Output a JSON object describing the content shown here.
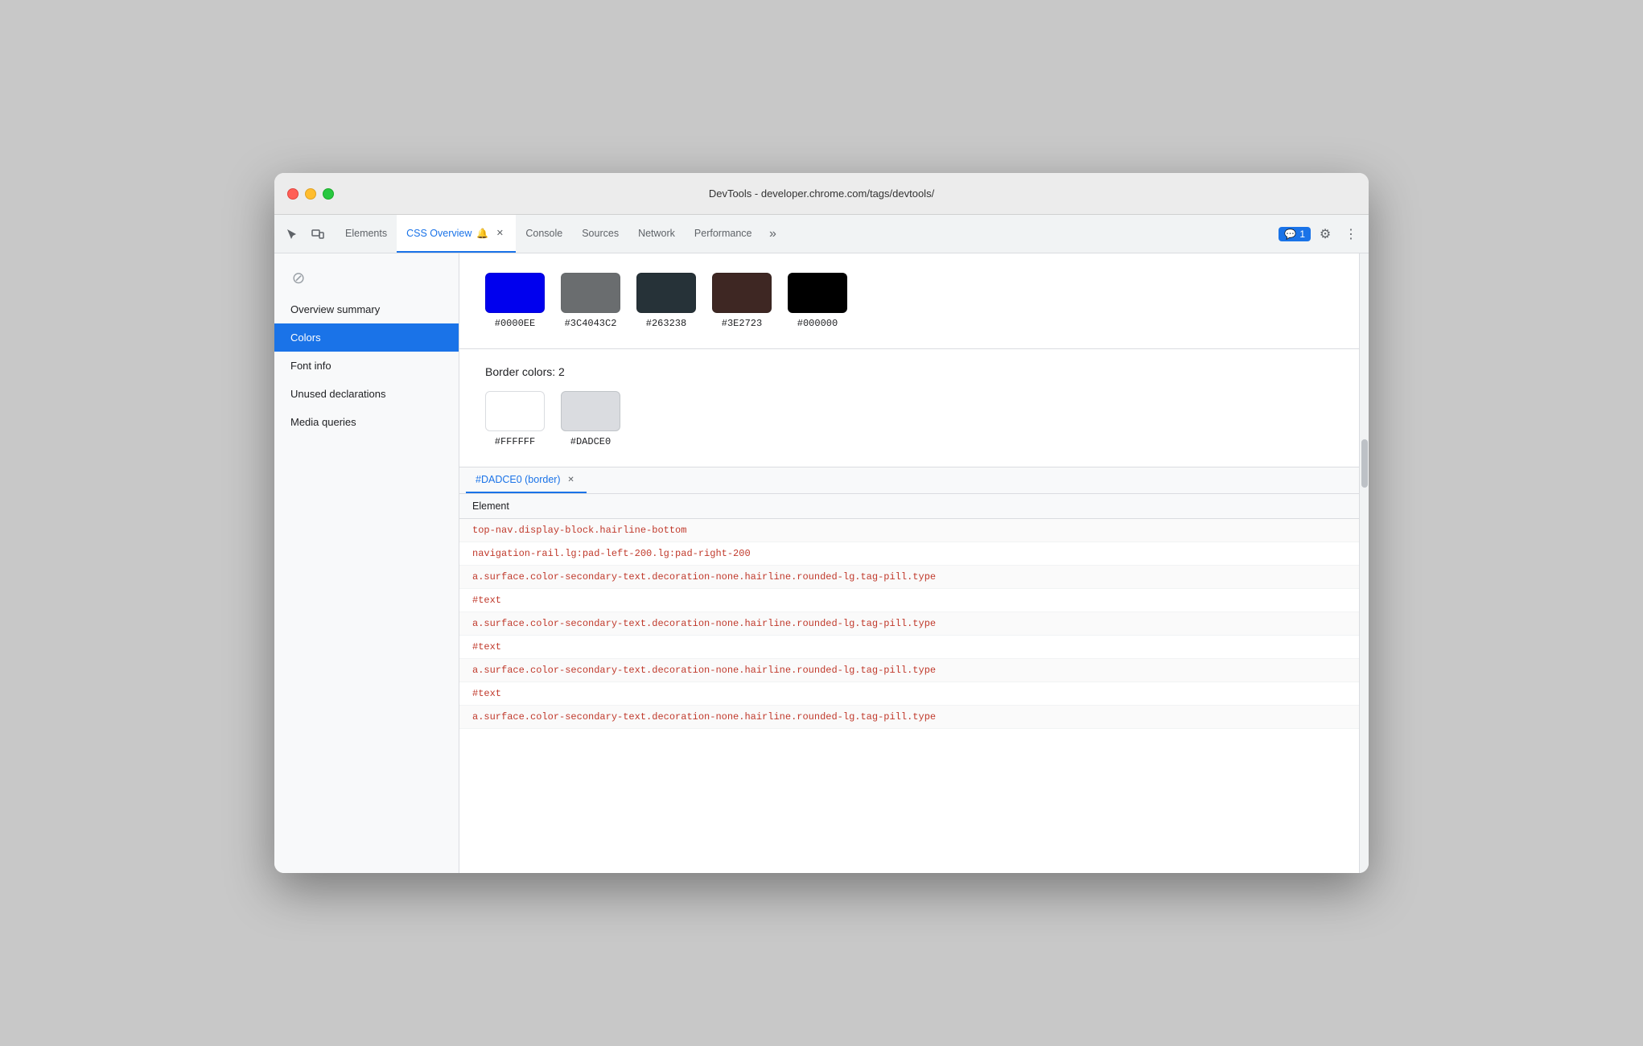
{
  "window": {
    "title": "DevTools - developer.chrome.com/tags/devtools/"
  },
  "tabs": [
    {
      "id": "elements",
      "label": "Elements",
      "active": false,
      "closable": false
    },
    {
      "id": "css-overview",
      "label": "CSS Overview",
      "active": true,
      "closable": true,
      "warn": true
    },
    {
      "id": "console",
      "label": "Console",
      "active": false,
      "closable": false
    },
    {
      "id": "sources",
      "label": "Sources",
      "active": false,
      "closable": false
    },
    {
      "id": "network",
      "label": "Network",
      "active": false,
      "closable": false
    },
    {
      "id": "performance",
      "label": "Performance",
      "active": false,
      "closable": false
    }
  ],
  "notification": {
    "icon": "💬",
    "count": "1"
  },
  "sidebar": {
    "items": [
      {
        "id": "overview-summary",
        "label": "Overview summary",
        "active": false
      },
      {
        "id": "colors",
        "label": "Colors",
        "active": true
      },
      {
        "id": "font-info",
        "label": "Font info",
        "active": false
      },
      {
        "id": "unused-declarations",
        "label": "Unused declarations",
        "active": false
      },
      {
        "id": "media-queries",
        "label": "Media queries",
        "active": false
      }
    ]
  },
  "colors_panel": {
    "text_colors": [
      {
        "hex": "#0000EE",
        "color": "#0000EE"
      },
      {
        "hex": "#3C4043C2",
        "color": "#3C4043"
      },
      {
        "hex": "#263238",
        "color": "#263238"
      },
      {
        "hex": "#3E2723",
        "color": "#3E2723"
      },
      {
        "hex": "#000000",
        "color": "#000000"
      }
    ],
    "border_colors_heading": "Border colors: 2",
    "border_colors": [
      {
        "hex": "#FFFFFF",
        "color": "#FFFFFF"
      },
      {
        "hex": "#DADCE0",
        "color": "#DADCE0"
      }
    ]
  },
  "element_panel": {
    "tab_label": "#DADCE0 (border)",
    "table_header": "Element",
    "rows": [
      {
        "text": "top-nav.display-block.hairline-bottom",
        "style": "link"
      },
      {
        "text": "navigation-rail.lg:pad-left-200.lg:pad-right-200",
        "style": "link"
      },
      {
        "text": "a.surface.color-secondary-text.decoration-none.hairline.rounded-lg.tag-pill.type",
        "style": "link"
      },
      {
        "text": "#text",
        "style": "text"
      },
      {
        "text": "a.surface.color-secondary-text.decoration-none.hairline.rounded-lg.tag-pill.type",
        "style": "link"
      },
      {
        "text": "#text",
        "style": "text"
      },
      {
        "text": "a.surface.color-secondary-text.decoration-none.hairline.rounded-lg.tag-pill.type",
        "style": "link"
      },
      {
        "text": "#text",
        "style": "text"
      },
      {
        "text": "a.surface.color-secondary-text.decoration-none.hairline.rounded-lg.tag-pill.type",
        "style": "link"
      }
    ]
  }
}
